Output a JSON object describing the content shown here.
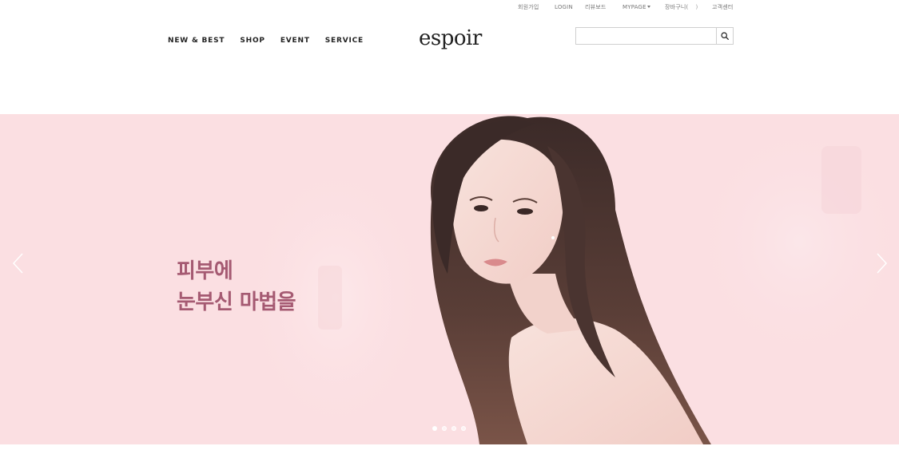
{
  "util_links": {
    "join": "회원가입",
    "login": "LOGIN",
    "review": "리뷰보드",
    "mypage": "MYPAGE",
    "cart": "장바구니(",
    "cart_count": ")",
    "cs": "고객센터"
  },
  "gnb": [
    "NEW & BEST",
    "SHOP",
    "EVENT",
    "SERVICE"
  ],
  "logo": "espoir",
  "search": {
    "placeholder": "",
    "value": ""
  },
  "hero": {
    "headline_line1": "피부에",
    "headline_line2": "눈부신 마법을",
    "slide_count": 4,
    "active_slide": 1
  },
  "colors": {
    "hero_bg": "#fbdfe2",
    "headline": "#a55a72",
    "text": "#222222"
  },
  "icons": {
    "search": "search-icon",
    "prev": "chevron-left-icon",
    "next": "chevron-right-icon"
  }
}
